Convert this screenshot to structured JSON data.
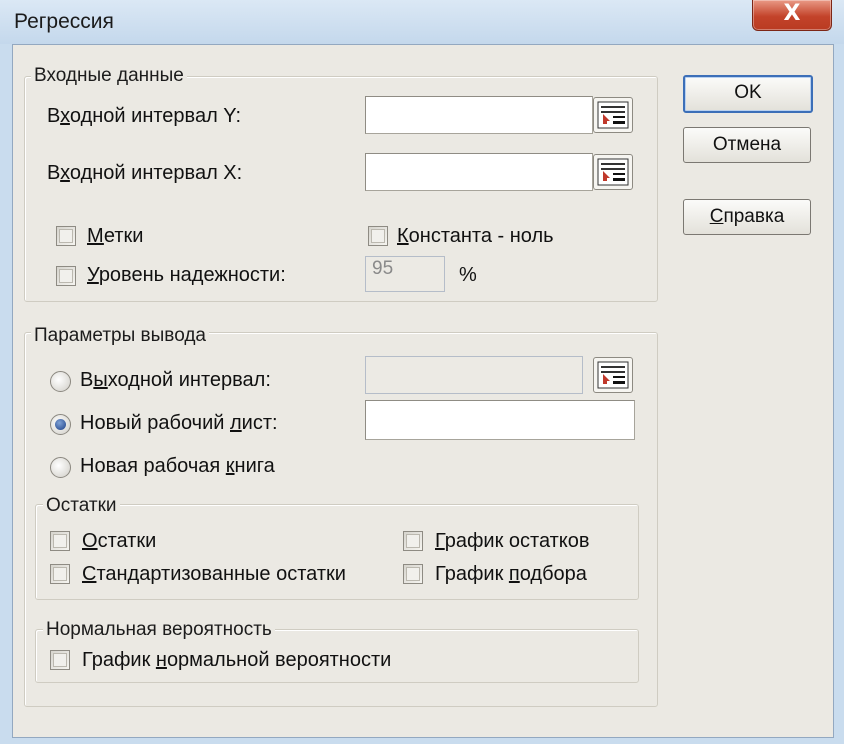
{
  "window": {
    "title": "Регрессия",
    "close_symbol": "X"
  },
  "input_group": {
    "legend": "Входные данные",
    "y_range_label": {
      "pre": "В",
      "u": "х",
      "post": "одной интервал Y:"
    },
    "y_range_value": "",
    "x_range_label": {
      "pre": "В",
      "u": "х",
      "post": "одной интервал X:"
    },
    "x_range_value": "",
    "labels_checkbox": {
      "pre": "",
      "u": "М",
      "post": "етки",
      "checked": false
    },
    "constant_zero_checkbox": {
      "pre": "",
      "u": "К",
      "post": "онстанта - ноль",
      "checked": false
    },
    "confidence_checkbox": {
      "pre": "",
      "u": "У",
      "post": "ровень надежности:",
      "checked": false
    },
    "confidence_value": "95",
    "confidence_unit": "%"
  },
  "output_group": {
    "legend": "Параметры вывода",
    "output_range_radio": {
      "pre": "В",
      "u": "ы",
      "post": "ходной интервал:",
      "checked": false
    },
    "output_range_value": "",
    "new_sheet_radio": {
      "pre": "Новый рабочий ",
      "u": "л",
      "post": "ист:",
      "checked": true
    },
    "new_sheet_value": "",
    "new_book_radio": {
      "pre": "Новая рабочая ",
      "u": "к",
      "post": "нига",
      "checked": false
    }
  },
  "residuals_group": {
    "legend": "Остатки",
    "residuals": {
      "pre": "",
      "u": "О",
      "post": "статки",
      "checked": false
    },
    "standardized": {
      "pre": "",
      "u": "С",
      "post": "тандартизованные остатки",
      "checked": false
    },
    "residual_plot": {
      "pre": "",
      "u": "Г",
      "post": "рафик остатков",
      "checked": false
    },
    "line_fit_plot": {
      "pre": "График ",
      "u": "п",
      "post": "одбора",
      "checked": false
    }
  },
  "normal_group": {
    "legend": "Нормальная вероятность",
    "normal_plot": {
      "pre": "График ",
      "u": "н",
      "post": "ормальной вероятности",
      "checked": false
    }
  },
  "buttons": {
    "ok": "OK",
    "cancel": "Отмена",
    "help": {
      "pre": "",
      "u": "С",
      "post": "правка"
    }
  }
}
